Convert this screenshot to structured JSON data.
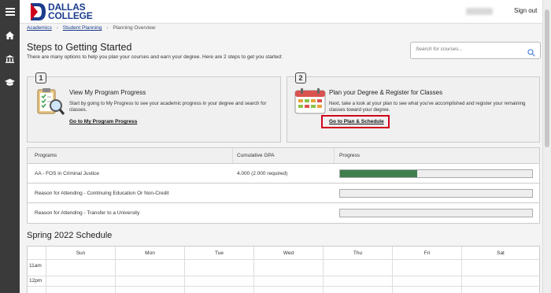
{
  "header": {
    "logo_line1": "DALLAS",
    "logo_line2": "COLLEGE",
    "signout_label": "Sign out",
    "brand_color": "#1a3c8c"
  },
  "sidebar": {
    "icons": [
      "hamburger-icon",
      "home-icon",
      "bank-icon",
      "graduation-cap-icon"
    ]
  },
  "breadcrumb": {
    "items": [
      "Academics",
      "Student Planning",
      "Planning Overview"
    ]
  },
  "page": {
    "title": "Steps to Getting Started",
    "intro": "There are many options to help you plan your courses and earn your degree. Here are 2 steps to get you started:"
  },
  "search": {
    "placeholder": "Search for courses..."
  },
  "steps": [
    {
      "number": "1",
      "title": "View My Program Progress",
      "description": "Start by going to My Progress to see your academic progress in your degree and search for classes.",
      "link": "Go to My Program Progress"
    },
    {
      "number": "2",
      "title": "Plan your Degree & Register for Classes",
      "description": "Next, take a look at your plan to see what you've accomplished and register your remaining classes toward your degree.",
      "link": "Go to Plan & Schedule"
    }
  ],
  "programs": {
    "headers": [
      "Programs",
      "Cumulative GPA",
      "Progress"
    ],
    "rows": [
      {
        "name": "AA - FOS in Criminal Justice",
        "gpa": "4.000 (2.000 required)",
        "progress": 0.4
      },
      {
        "name": "Reason for Attending - Continuing Education Or Non-Credit",
        "gpa": "",
        "progress": 0
      },
      {
        "name": "Reason for Attending - Transfer to a University",
        "gpa": "",
        "progress": 0
      }
    ],
    "progress_color": "#3e7e4f"
  },
  "schedule": {
    "title": "Spring 2022 Schedule",
    "days": [
      "Sun",
      "Mon",
      "Tue",
      "Wed",
      "Thu",
      "Fri",
      "Sat"
    ],
    "times": [
      "11am",
      "12pm"
    ]
  }
}
